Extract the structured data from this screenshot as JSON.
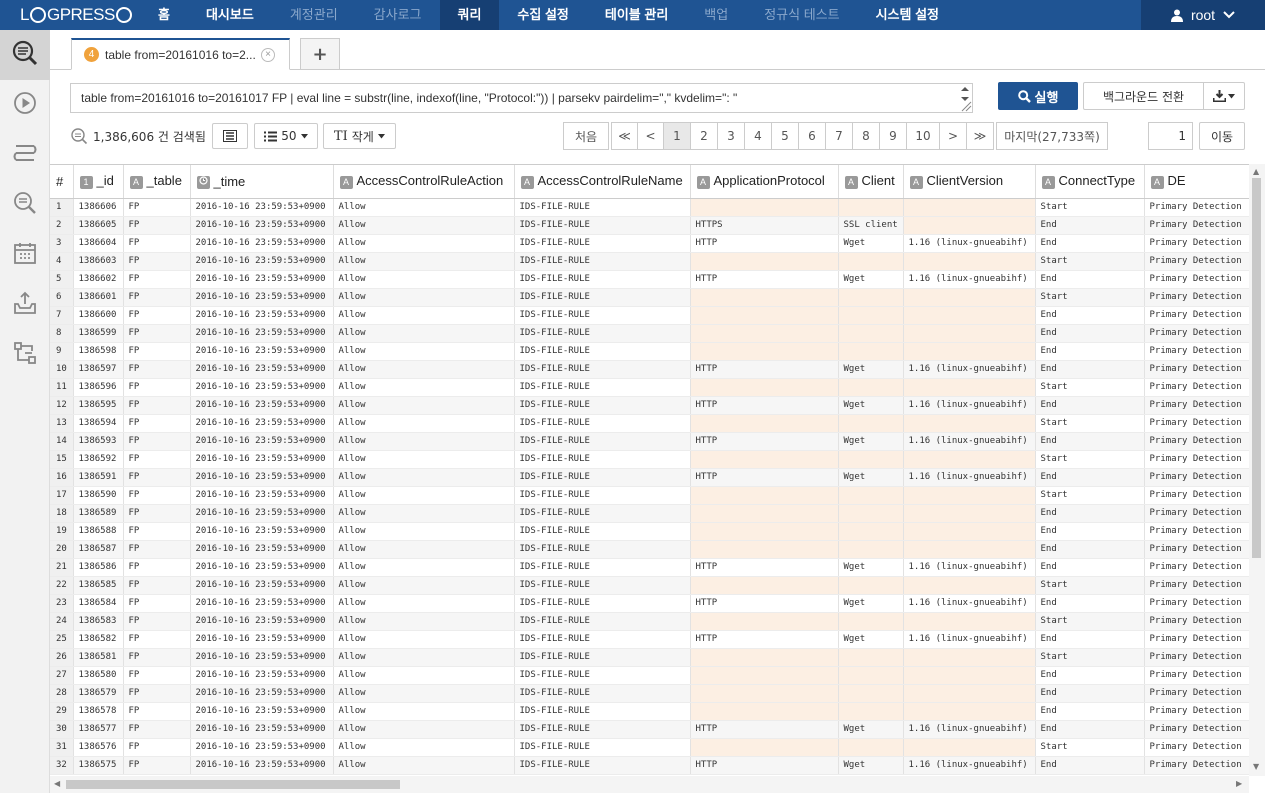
{
  "app": {
    "logo": "LOGPRESSO"
  },
  "nav": [
    {
      "label": "홈",
      "state": "normal"
    },
    {
      "label": "대시보드",
      "state": "normal"
    },
    {
      "label": "계정관리",
      "state": "dim"
    },
    {
      "label": "감사로그",
      "state": "dim"
    },
    {
      "label": "쿼리",
      "state": "active"
    },
    {
      "label": "수집 설정",
      "state": "normal"
    },
    {
      "label": "테이블 관리",
      "state": "normal"
    },
    {
      "label": "백업",
      "state": "dim"
    },
    {
      "label": "정규식 테스트",
      "state": "dim"
    },
    {
      "label": "시스템 설정",
      "state": "normal"
    }
  ],
  "user": {
    "name": "root"
  },
  "sidebar": [
    "query-icon",
    "play-icon",
    "stream-icon",
    "search-log-icon",
    "calendar-icon",
    "upload-icon",
    "flow-icon"
  ],
  "tab": {
    "badge": "4",
    "title": "table from=20161016 to=2..."
  },
  "query": {
    "text": "table from=20161016 to=20161017 FP | eval line = substr(line, indexof(line, \"Protocol:\")) | parsekv pairdelim=\",\" kvdelim=\": \""
  },
  "buttons": {
    "run": "실행",
    "background": "백그라운드 전환"
  },
  "toolbar": {
    "count": "1,386,606 건 검색됨",
    "page_size": "50",
    "text_size": "작게"
  },
  "pager": {
    "first": "처음",
    "prev_group": "≪",
    "prev": "<",
    "pages": [
      "1",
      "2",
      "3",
      "4",
      "5",
      "6",
      "7",
      "8",
      "9",
      "10"
    ],
    "next": ">",
    "next_group": "≫",
    "last": "마지막(27,733쪽)",
    "goto_value": "1",
    "goto_label": "이동"
  },
  "colors": {
    "accent": "#1f5493",
    "badge": "#f0a23c",
    "empty_cell": "#fcefe3"
  },
  "table": {
    "columns": [
      {
        "icon": "",
        "label": "#"
      },
      {
        "icon": "1",
        "label": "_id"
      },
      {
        "icon": "A",
        "label": "_table"
      },
      {
        "icon": "clock",
        "label": "_time"
      },
      {
        "icon": "A",
        "label": "AccessControlRuleAction"
      },
      {
        "icon": "A",
        "label": "AccessControlRuleName"
      },
      {
        "icon": "A",
        "label": "ApplicationProtocol"
      },
      {
        "icon": "A",
        "label": "Client"
      },
      {
        "icon": "A",
        "label": "ClientVersion"
      },
      {
        "icon": "A",
        "label": "ConnectType"
      },
      {
        "icon": "A",
        "label": "DE"
      }
    ],
    "rows": [
      [
        "1",
        "1386606",
        "FP",
        "2016-10-16 23:59:53+0900",
        "Allow",
        "IDS-FILE-RULE",
        "",
        "",
        "",
        "Start",
        "Primary Detection"
      ],
      [
        "2",
        "1386605",
        "FP",
        "2016-10-16 23:59:53+0900",
        "Allow",
        "IDS-FILE-RULE",
        "HTTPS",
        "SSL client",
        "",
        "End",
        "Primary Detection"
      ],
      [
        "3",
        "1386604",
        "FP",
        "2016-10-16 23:59:53+0900",
        "Allow",
        "IDS-FILE-RULE",
        "HTTP",
        "Wget",
        "1.16 (linux-gnueabihf)",
        "End",
        "Primary Detection"
      ],
      [
        "4",
        "1386603",
        "FP",
        "2016-10-16 23:59:53+0900",
        "Allow",
        "IDS-FILE-RULE",
        "",
        "",
        "",
        "Start",
        "Primary Detection"
      ],
      [
        "5",
        "1386602",
        "FP",
        "2016-10-16 23:59:53+0900",
        "Allow",
        "IDS-FILE-RULE",
        "HTTP",
        "Wget",
        "1.16 (linux-gnueabihf)",
        "End",
        "Primary Detection"
      ],
      [
        "6",
        "1386601",
        "FP",
        "2016-10-16 23:59:53+0900",
        "Allow",
        "IDS-FILE-RULE",
        "",
        "",
        "",
        "Start",
        "Primary Detection"
      ],
      [
        "7",
        "1386600",
        "FP",
        "2016-10-16 23:59:53+0900",
        "Allow",
        "IDS-FILE-RULE",
        "",
        "",
        "",
        "End",
        "Primary Detection"
      ],
      [
        "8",
        "1386599",
        "FP",
        "2016-10-16 23:59:53+0900",
        "Allow",
        "IDS-FILE-RULE",
        "",
        "",
        "",
        "End",
        "Primary Detection"
      ],
      [
        "9",
        "1386598",
        "FP",
        "2016-10-16 23:59:53+0900",
        "Allow",
        "IDS-FILE-RULE",
        "",
        "",
        "",
        "End",
        "Primary Detection"
      ],
      [
        "10",
        "1386597",
        "FP",
        "2016-10-16 23:59:53+0900",
        "Allow",
        "IDS-FILE-RULE",
        "HTTP",
        "Wget",
        "1.16 (linux-gnueabihf)",
        "End",
        "Primary Detection"
      ],
      [
        "11",
        "1386596",
        "FP",
        "2016-10-16 23:59:53+0900",
        "Allow",
        "IDS-FILE-RULE",
        "",
        "",
        "",
        "Start",
        "Primary Detection"
      ],
      [
        "12",
        "1386595",
        "FP",
        "2016-10-16 23:59:53+0900",
        "Allow",
        "IDS-FILE-RULE",
        "HTTP",
        "Wget",
        "1.16 (linux-gnueabihf)",
        "End",
        "Primary Detection"
      ],
      [
        "13",
        "1386594",
        "FP",
        "2016-10-16 23:59:53+0900",
        "Allow",
        "IDS-FILE-RULE",
        "",
        "",
        "",
        "Start",
        "Primary Detection"
      ],
      [
        "14",
        "1386593",
        "FP",
        "2016-10-16 23:59:53+0900",
        "Allow",
        "IDS-FILE-RULE",
        "HTTP",
        "Wget",
        "1.16 (linux-gnueabihf)",
        "End",
        "Primary Detection"
      ],
      [
        "15",
        "1386592",
        "FP",
        "2016-10-16 23:59:53+0900",
        "Allow",
        "IDS-FILE-RULE",
        "",
        "",
        "",
        "Start",
        "Primary Detection"
      ],
      [
        "16",
        "1386591",
        "FP",
        "2016-10-16 23:59:53+0900",
        "Allow",
        "IDS-FILE-RULE",
        "HTTP",
        "Wget",
        "1.16 (linux-gnueabihf)",
        "End",
        "Primary Detection"
      ],
      [
        "17",
        "1386590",
        "FP",
        "2016-10-16 23:59:53+0900",
        "Allow",
        "IDS-FILE-RULE",
        "",
        "",
        "",
        "Start",
        "Primary Detection"
      ],
      [
        "18",
        "1386589",
        "FP",
        "2016-10-16 23:59:53+0900",
        "Allow",
        "IDS-FILE-RULE",
        "",
        "",
        "",
        "End",
        "Primary Detection"
      ],
      [
        "19",
        "1386588",
        "FP",
        "2016-10-16 23:59:53+0900",
        "Allow",
        "IDS-FILE-RULE",
        "",
        "",
        "",
        "End",
        "Primary Detection"
      ],
      [
        "20",
        "1386587",
        "FP",
        "2016-10-16 23:59:53+0900",
        "Allow",
        "IDS-FILE-RULE",
        "",
        "",
        "",
        "End",
        "Primary Detection"
      ],
      [
        "21",
        "1386586",
        "FP",
        "2016-10-16 23:59:53+0900",
        "Allow",
        "IDS-FILE-RULE",
        "HTTP",
        "Wget",
        "1.16 (linux-gnueabihf)",
        "End",
        "Primary Detection"
      ],
      [
        "22",
        "1386585",
        "FP",
        "2016-10-16 23:59:53+0900",
        "Allow",
        "IDS-FILE-RULE",
        "",
        "",
        "",
        "Start",
        "Primary Detection"
      ],
      [
        "23",
        "1386584",
        "FP",
        "2016-10-16 23:59:53+0900",
        "Allow",
        "IDS-FILE-RULE",
        "HTTP",
        "Wget",
        "1.16 (linux-gnueabihf)",
        "End",
        "Primary Detection"
      ],
      [
        "24",
        "1386583",
        "FP",
        "2016-10-16 23:59:53+0900",
        "Allow",
        "IDS-FILE-RULE",
        "",
        "",
        "",
        "Start",
        "Primary Detection"
      ],
      [
        "25",
        "1386582",
        "FP",
        "2016-10-16 23:59:53+0900",
        "Allow",
        "IDS-FILE-RULE",
        "HTTP",
        "Wget",
        "1.16 (linux-gnueabihf)",
        "End",
        "Primary Detection"
      ],
      [
        "26",
        "1386581",
        "FP",
        "2016-10-16 23:59:53+0900",
        "Allow",
        "IDS-FILE-RULE",
        "",
        "",
        "",
        "Start",
        "Primary Detection"
      ],
      [
        "27",
        "1386580",
        "FP",
        "2016-10-16 23:59:53+0900",
        "Allow",
        "IDS-FILE-RULE",
        "",
        "",
        "",
        "End",
        "Primary Detection"
      ],
      [
        "28",
        "1386579",
        "FP",
        "2016-10-16 23:59:53+0900",
        "Allow",
        "IDS-FILE-RULE",
        "",
        "",
        "",
        "End",
        "Primary Detection"
      ],
      [
        "29",
        "1386578",
        "FP",
        "2016-10-16 23:59:53+0900",
        "Allow",
        "IDS-FILE-RULE",
        "",
        "",
        "",
        "End",
        "Primary Detection"
      ],
      [
        "30",
        "1386577",
        "FP",
        "2016-10-16 23:59:53+0900",
        "Allow",
        "IDS-FILE-RULE",
        "HTTP",
        "Wget",
        "1.16 (linux-gnueabihf)",
        "End",
        "Primary Detection"
      ],
      [
        "31",
        "1386576",
        "FP",
        "2016-10-16 23:59:53+0900",
        "Allow",
        "IDS-FILE-RULE",
        "",
        "",
        "",
        "Start",
        "Primary Detection"
      ],
      [
        "32",
        "1386575",
        "FP",
        "2016-10-16 23:59:53+0900",
        "Allow",
        "IDS-FILE-RULE",
        "HTTP",
        "Wget",
        "1.16 (linux-gnueabihf)",
        "End",
        "Primary Detection"
      ]
    ]
  }
}
